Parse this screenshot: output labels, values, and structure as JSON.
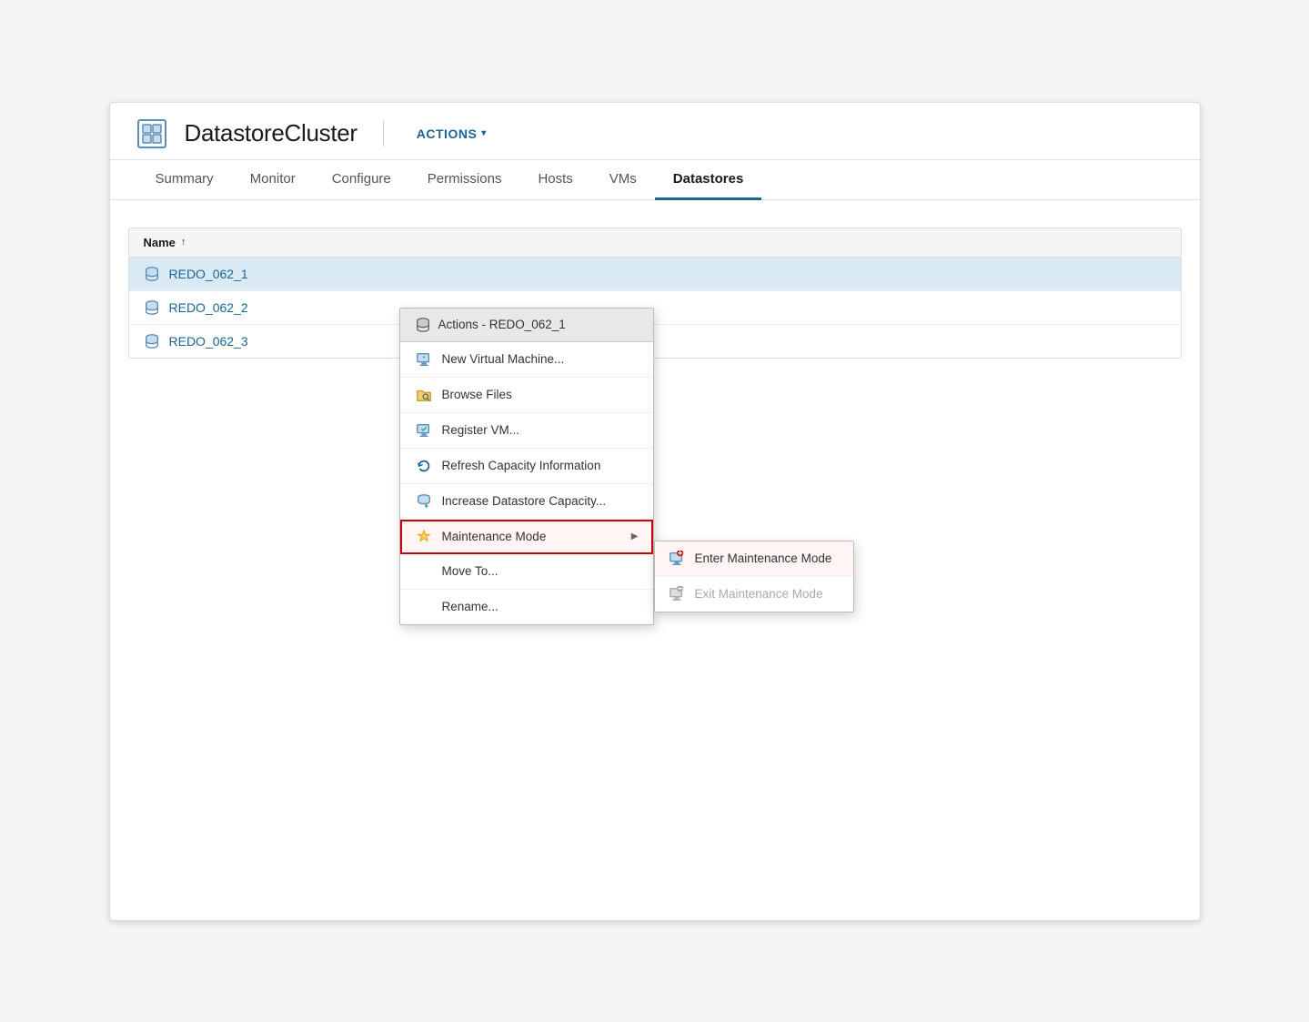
{
  "header": {
    "title": "DatastoreCluster",
    "actions_label": "ACTIONS",
    "chevron": "▾"
  },
  "tabs": [
    {
      "id": "summary",
      "label": "Summary",
      "active": false
    },
    {
      "id": "monitor",
      "label": "Monitor",
      "active": false
    },
    {
      "id": "configure",
      "label": "Configure",
      "active": false
    },
    {
      "id": "permissions",
      "label": "Permissions",
      "active": false
    },
    {
      "id": "hosts",
      "label": "Hosts",
      "active": false
    },
    {
      "id": "vms",
      "label": "VMs",
      "active": false
    },
    {
      "id": "datastores",
      "label": "Datastores",
      "active": true
    }
  ],
  "table": {
    "column_name": "Name",
    "sort_indicator": "↑",
    "rows": [
      {
        "id": "row1",
        "name": "REDO_062_1",
        "selected": true
      },
      {
        "id": "row2",
        "name": "REDO_062_2",
        "selected": false
      },
      {
        "id": "row3",
        "name": "REDO_062_3",
        "selected": false
      }
    ]
  },
  "context_menu": {
    "header_icon": "⊞",
    "header_label": "Actions - REDO_062_1",
    "items": [
      {
        "id": "new-vm",
        "icon": "⊞",
        "label": "New Virtual Machine...",
        "has_submenu": false
      },
      {
        "id": "browse-files",
        "icon": "📁",
        "label": "Browse Files",
        "has_submenu": false
      },
      {
        "id": "register-vm",
        "icon": "⊟",
        "label": "Register VM...",
        "has_submenu": false
      },
      {
        "id": "refresh-capacity",
        "icon": "↻",
        "label": "Refresh Capacity Information",
        "has_submenu": false
      },
      {
        "id": "increase-capacity",
        "icon": "⊞",
        "label": "Increase Datastore Capacity...",
        "has_submenu": false
      },
      {
        "id": "maintenance-mode",
        "icon": "",
        "label": "Maintenance Mode",
        "has_submenu": true,
        "highlighted": true
      },
      {
        "id": "move-to",
        "icon": "",
        "label": "Move To...",
        "has_submenu": false
      },
      {
        "id": "rename",
        "icon": "",
        "label": "Rename...",
        "has_submenu": false
      }
    ]
  },
  "submenu": {
    "items": [
      {
        "id": "enter-maintenance",
        "label": "Enter Maintenance Mode",
        "disabled": false
      },
      {
        "id": "exit-maintenance",
        "label": "Exit Maintenance Mode",
        "disabled": true
      }
    ]
  },
  "colors": {
    "accent_blue": "#1a6496",
    "selected_row_bg": "#d9eaf5",
    "maintenance_border": "#cc0000",
    "submenu_highlight_bg": "#fff5f5"
  }
}
